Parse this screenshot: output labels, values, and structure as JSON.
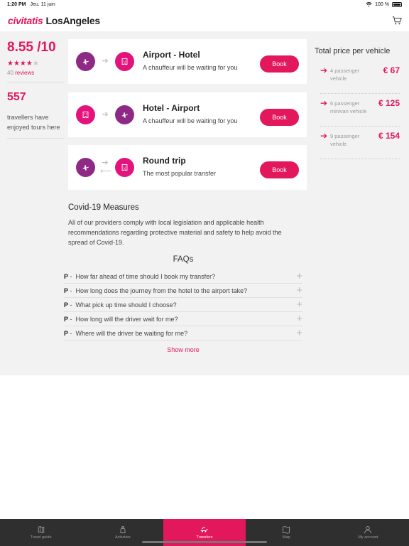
{
  "status": {
    "time": "1:20 PM",
    "date": "Jeu. 11 juin",
    "battery": "100 %"
  },
  "header": {
    "brand": "civitatis",
    "city": "LosAngeles"
  },
  "summary": {
    "rating": "8.55 /10",
    "stars": "★★★★",
    "reviews_count": "40",
    "reviews_label": "reviews",
    "travellers_count": "557",
    "travellers_label": "travellers have enjoyed tours here"
  },
  "transfers": [
    {
      "title": "Airport - Hotel",
      "subtitle": "A chauffeur will be waiting for you",
      "button": "Book",
      "from_icon": "plane-icon",
      "to_icon": "hotel-icon"
    },
    {
      "title": "Hotel - Airport",
      "subtitle": "A chauffeur will be waiting for you",
      "button": "Book",
      "from_icon": "hotel-icon",
      "to_icon": "plane-icon"
    },
    {
      "title": "Round trip",
      "subtitle": "The most popular transfer",
      "button": "Book",
      "from_icon": "plane-icon",
      "to_icon": "hotel-icon"
    }
  ],
  "pricing": {
    "title": "Total price per vehicle",
    "rows": [
      {
        "label": "4 passenger vehicle",
        "price": "€ 67"
      },
      {
        "label": "6 passenger minivan vehicle",
        "price": "€ 125"
      },
      {
        "label": "9 passenger vehicle",
        "price": "€ 154"
      }
    ]
  },
  "covid": {
    "title": "Covid-19 Measures",
    "text": "All of our providers comply with local legislation and applicable health recommendations regarding protective material and safety to help avoid the spread of Covid-19."
  },
  "faqs": {
    "title": "FAQs",
    "prefix": "P",
    "items": [
      "How far ahead of time should I book my transfer?",
      "How long does the journey from the hotel to the airport take?",
      "What pick up time should I choose?",
      "How long will the driver wait for me?",
      "Where will the driver be waiting for me?"
    ],
    "show_more": "Show more"
  },
  "tabs": [
    {
      "label": "Travel guide",
      "icon": "map-book-icon"
    },
    {
      "label": "Activities",
      "icon": "tourist-icon"
    },
    {
      "label": "Transfers",
      "icon": "transfer-icon"
    },
    {
      "label": "Map",
      "icon": "map-icon"
    },
    {
      "label": "My account",
      "icon": "person-icon"
    }
  ],
  "colors": {
    "brand": "#e3175b",
    "purple": "#8e2a86",
    "pink_icon": "#e3127d",
    "tabbar": "#2f2f2f"
  }
}
